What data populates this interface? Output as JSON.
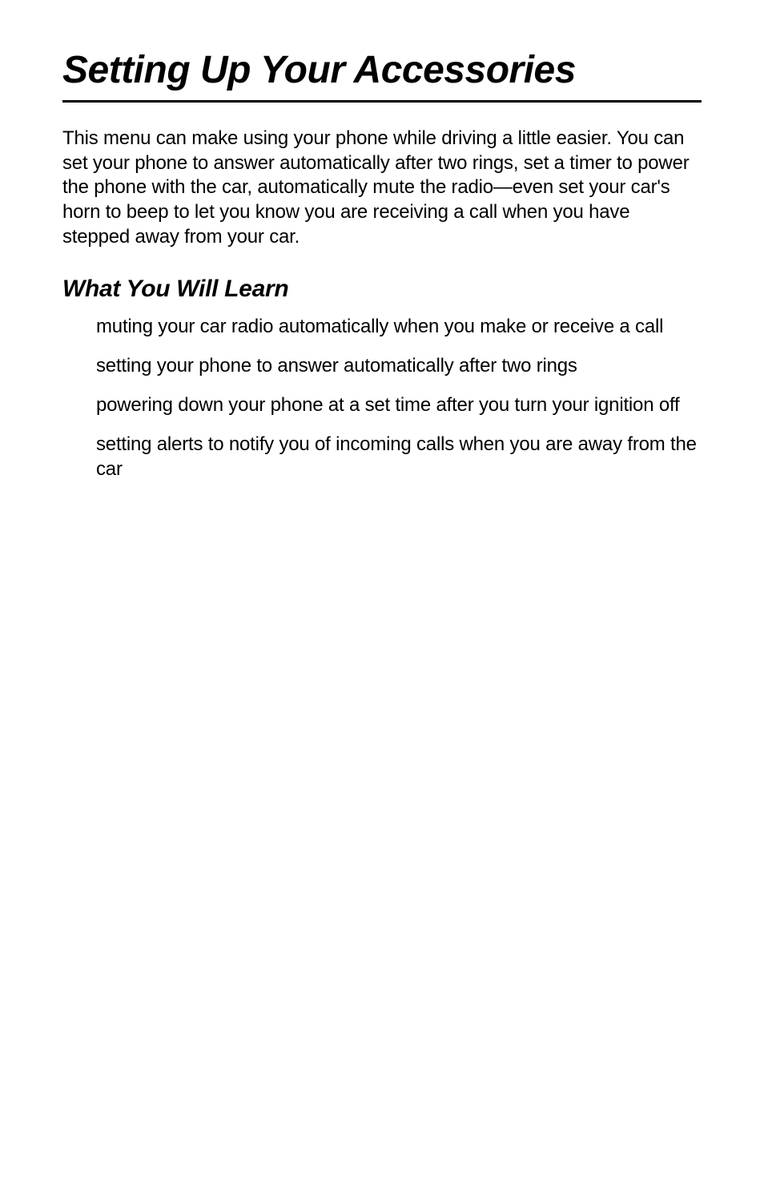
{
  "title": "Setting Up Your Accessories",
  "intro": "This menu can make using your phone while driving a little easier. You can set your phone to answer automatically after two rings, set a timer to power the phone with the car, automatically mute the radio—even set your car's horn to beep to let you know you are receiving a call when you have stepped away from your car.",
  "subhead": "What You Will Learn",
  "learn": {
    "item1": "muting your car radio automatically when you make or receive a call",
    "item2": "setting your phone to answer automatically after two rings",
    "item3": "powering down your phone at a set time after you turn your ignition off",
    "item4": "setting alerts to notify you of incoming calls when you are away from the car"
  }
}
